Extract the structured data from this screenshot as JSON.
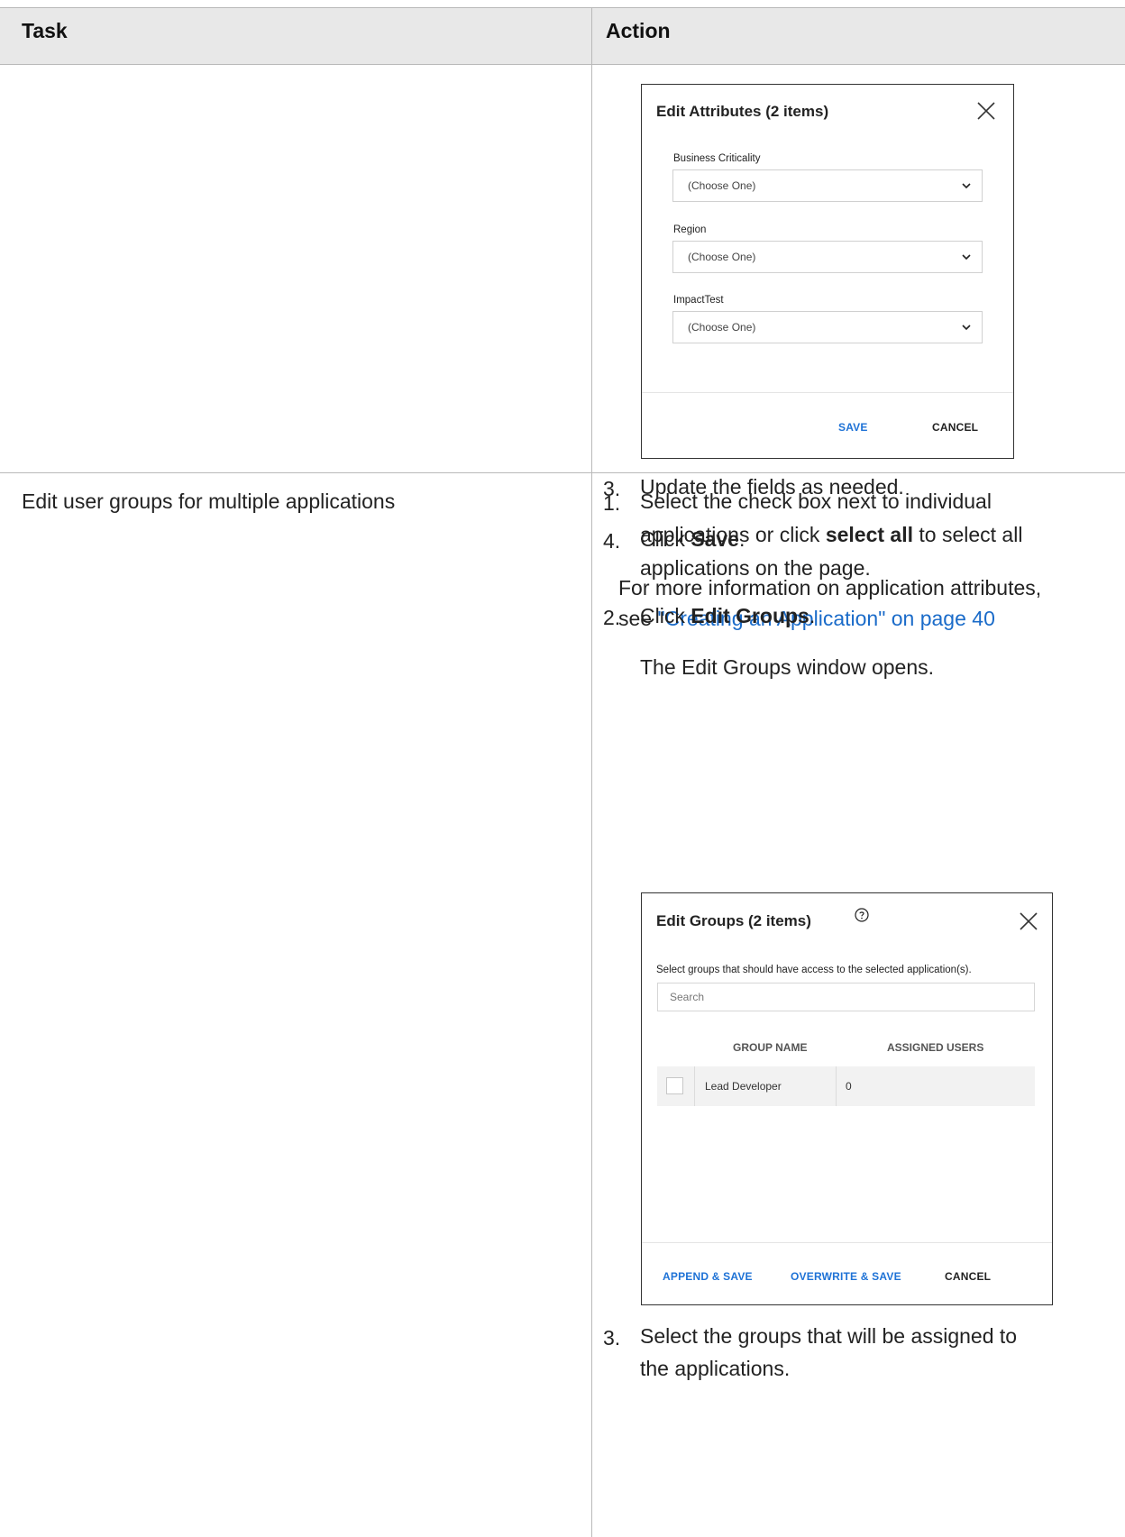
{
  "table": {
    "headers": {
      "task": "Task",
      "action": "Action"
    }
  },
  "row1": {
    "dialog": {
      "title": "Edit Attributes (2 items)",
      "fields": [
        {
          "label": "Business Criticality",
          "value": "(Choose One)"
        },
        {
          "label": "Region",
          "value": "(Choose One)"
        },
        {
          "label": "ImpactTest",
          "value": "(Choose One)"
        }
      ],
      "save": "SAVE",
      "cancel": "CANCEL"
    },
    "steps": [
      {
        "num": "3.",
        "text": "Update the fields as needed."
      },
      {
        "num": "4.",
        "pre": "Click ",
        "bold": "Save",
        "post": "."
      }
    ],
    "more_info": {
      "line1": "For more information on application attributes,",
      "pre": "see ",
      "link": "\"Creating an Application\" on page 40"
    }
  },
  "row2": {
    "task": "Edit user groups for multiple applications",
    "step1": {
      "num": "1.",
      "line1": "Select the check box next to individual",
      "line2_pre": "applications or click ",
      "line2_bold": "select all",
      "line2_post": " to select all",
      "line3": "applications on the page."
    },
    "step2": {
      "num": "2.",
      "pre": "Click ",
      "bold": "Edit Groups",
      "post": "."
    },
    "note": "The Edit Groups window opens.",
    "dialog": {
      "title": "Edit Groups (2 items)",
      "instruction": "Select groups that should have access to the selected application(s).",
      "search_placeholder": "Search",
      "columns": [
        "GROUP NAME",
        "ASSIGNED USERS"
      ],
      "rows": [
        {
          "name": "Lead Developer",
          "users": "0"
        }
      ],
      "append_save": "APPEND & SAVE",
      "overwrite_save": "OVERWRITE & SAVE",
      "cancel": "CANCEL"
    },
    "step3": {
      "num": "3.",
      "line1": "Select the groups that will be assigned to",
      "line2": "the applications."
    }
  }
}
